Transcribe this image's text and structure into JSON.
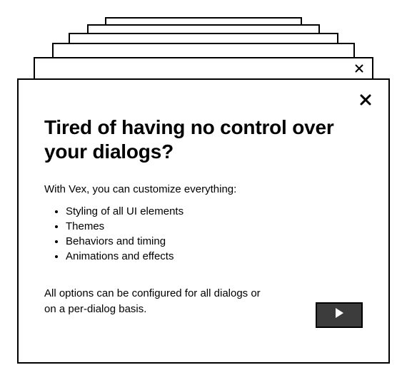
{
  "dialog": {
    "title": "Tired of having no control over your dialogs?",
    "intro": "With Vex, you can customize everything:",
    "bullets": [
      "Styling of all UI elements",
      "Themes",
      "Behaviors and timing",
      "Animations and effects"
    ],
    "footnote": "All options can be configured for all dialogs or on a per-dialog basis."
  }
}
